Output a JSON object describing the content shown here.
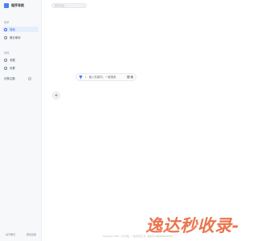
{
  "app": {
    "logo_text": "程序导航"
  },
  "sidebar": {
    "groups": [
      {
        "title": "菜单"
      },
      {
        "title": "其他"
      }
    ],
    "items": [
      {
        "label": "搜索",
        "icon": "search-icon",
        "active": true
      },
      {
        "label": "最近使用",
        "icon": "clock-icon",
        "active": false
      },
      {
        "label": "收藏",
        "icon": "star-icon",
        "active": false
      },
      {
        "label": "设置",
        "icon": "gear-icon",
        "active": false
      },
      {
        "label": "切换主题",
        "icon": "theme-icon",
        "active": false
      }
    ],
    "bottom_links": [
      "关于我们",
      "意见反馈"
    ]
  },
  "top_search": {
    "placeholder": "搜索书签..."
  },
  "main_search": {
    "placeholder": "输入关键词，一键搜索",
    "button_label": "搜 索",
    "engine_icon": "engine-icon"
  },
  "footer": {
    "text": "Copyright © 2024 · 分享导航 · 一站式导航工具 · 备案号ICP备2024000000号"
  },
  "watermark": {
    "text": "逸达秒收录-"
  },
  "colors": {
    "accent": "#3b6cf6",
    "watermark": "#e6501e"
  }
}
